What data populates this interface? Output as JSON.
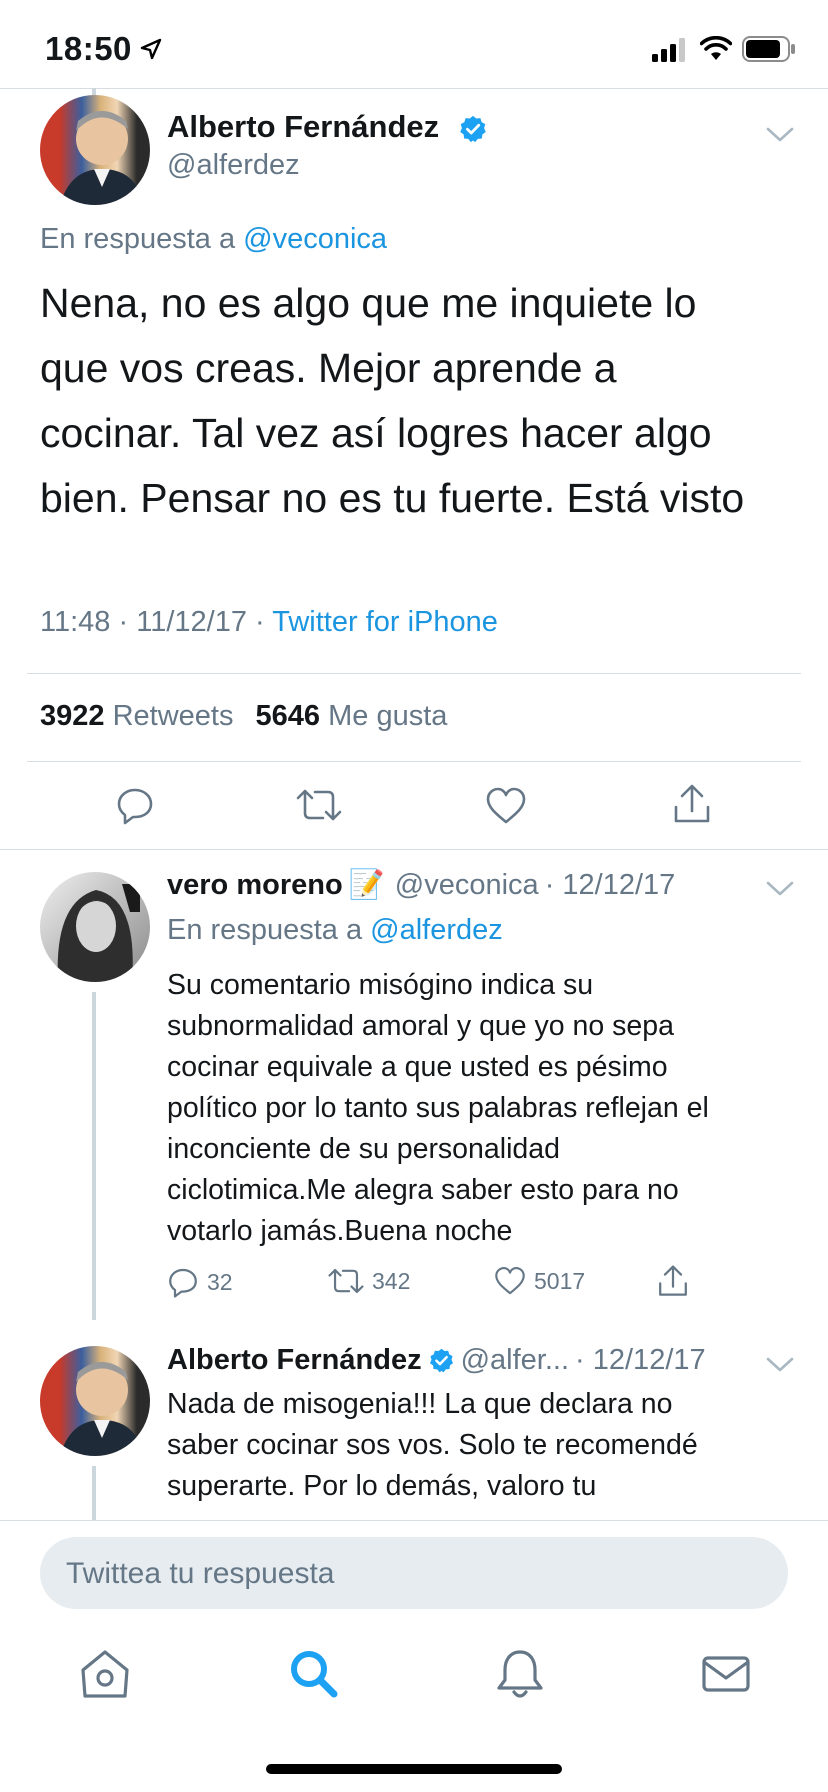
{
  "status_bar": {
    "time": "18:50"
  },
  "main_tweet": {
    "author_name": "Alberto Fernández",
    "handle": "@alferdez",
    "reply_prefix": "En respuesta a",
    "reply_to": "@veconica",
    "text_lines": [
      "Nena, no es algo que me inquiete lo",
      "que vos creas. Mejor aprende a",
      "cocinar. Tal vez así logres hacer algo",
      "bien. Pensar no es tu fuerte. Está visto"
    ],
    "time": "11:48",
    "date": "11/12/17",
    "separator": "·",
    "source": "Twitter for iPhone",
    "retweets_count": "3922",
    "retweets_label": "Retweets",
    "likes_count": "5646",
    "likes_label": "Me gusta"
  },
  "reply1": {
    "author_name": "vero moreno",
    "emoji": "📝",
    "handle": "@veconica",
    "date": "· 12/12/17",
    "reply_prefix": "En respuesta a",
    "reply_to": "@alferdez",
    "text_lines": [
      "Su comentario misógino indica su",
      "subnormalidad amoral y que yo no sepa",
      "cocinar equivale a que usted es pésimo",
      "político por lo tanto sus palabras reflejan el",
      "inconciente de su personalidad",
      "ciclotimica.Me alegra saber esto para no",
      "votarlo jamás.Buena noche"
    ],
    "replies": "32",
    "retweets": "342",
    "likes": "5017"
  },
  "reply2": {
    "author_name": "Alberto Fernández",
    "handle": "@alfer...",
    "date": "· 12/12/17",
    "text_lines": [
      "Nada de misogenia!!! La que declara no",
      "saber cocinar sos vos. Solo te recomendé",
      "superarte. Por lo demás, valoro tu"
    ]
  },
  "composer": {
    "placeholder": "Twittea tu respuesta"
  },
  "colors": {
    "accent": "#1b95e0",
    "secondary": "#657786",
    "divider": "#d8dde2",
    "pill": "#e6ecf0"
  },
  "tab_bar": {
    "icons": [
      "home-icon",
      "search-icon",
      "notifications-icon",
      "messages-icon"
    ],
    "active": "search-icon"
  }
}
